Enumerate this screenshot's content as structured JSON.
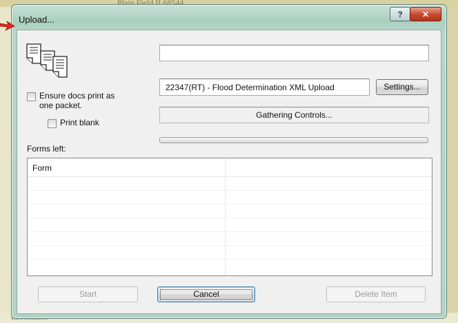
{
  "background": {
    "ghost_top": "Plain Field II  68544",
    "ghost_bottom": "Information"
  },
  "window": {
    "title": "Upload...",
    "help_label": "?",
    "close_label": "✕"
  },
  "icons": {
    "documents": "documents-icon",
    "arrow": "red-arrow-pointer"
  },
  "options": {
    "ensure_docs_label": "Ensure docs print as one packet.",
    "ensure_docs_checked": false,
    "print_blank_label": "Print blank",
    "print_blank_checked": false
  },
  "fields": {
    "top_field_value": "",
    "upload_name": "22347(RT) - Flood Determination XML Upload",
    "status_text": "Gathering Controls...",
    "progress_value": 0
  },
  "buttons": {
    "settings": "Settings...",
    "start": "Start",
    "cancel": "Cancel",
    "delete_item": "Delete Item"
  },
  "list": {
    "label": "Forms left:",
    "columns": [
      "Form",
      ""
    ],
    "rows": []
  },
  "colors": {
    "arrow": "#e0261b",
    "progress": "#3fbf3a"
  }
}
